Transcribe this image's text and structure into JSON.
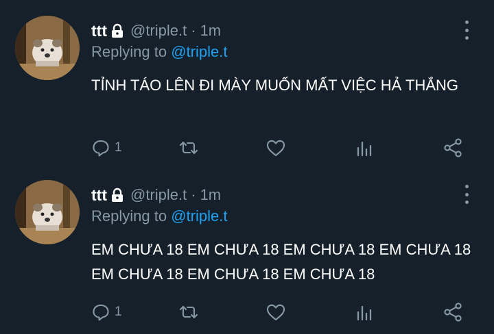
{
  "colors": {
    "background": "#15202b",
    "text_primary": "#ffffff",
    "text_secondary": "#8899a6",
    "mention": "#1da1f2"
  },
  "tweets": [
    {
      "name": "ttt",
      "handle": "@triple.t",
      "separator": "·",
      "time": "1m",
      "replying_prefix": "Replying to",
      "replying_to": "@triple.t",
      "text": "TỈNH TÁO LÊN ĐI MÀY MUỐN MẤT VIỆC HẢ THẮNG",
      "reply_count": "1",
      "icons": [
        "lock-icon",
        "more-icon",
        "reply-icon",
        "retweet-icon",
        "like-icon",
        "analytics-icon",
        "share-icon"
      ]
    },
    {
      "name": "ttt",
      "handle": "@triple.t",
      "separator": "·",
      "time": "1m",
      "replying_prefix": "Replying to",
      "replying_to": "@triple.t",
      "text": "EM CHƯA 18 EM CHƯA 18 EM CHƯA 18 EM CHƯA 18 EM CHƯA 18 EM CHƯA 18 EM CHƯA 18",
      "reply_count": "1",
      "icons": [
        "lock-icon",
        "more-icon",
        "reply-icon",
        "retweet-icon",
        "like-icon",
        "analytics-icon",
        "share-icon"
      ]
    }
  ]
}
